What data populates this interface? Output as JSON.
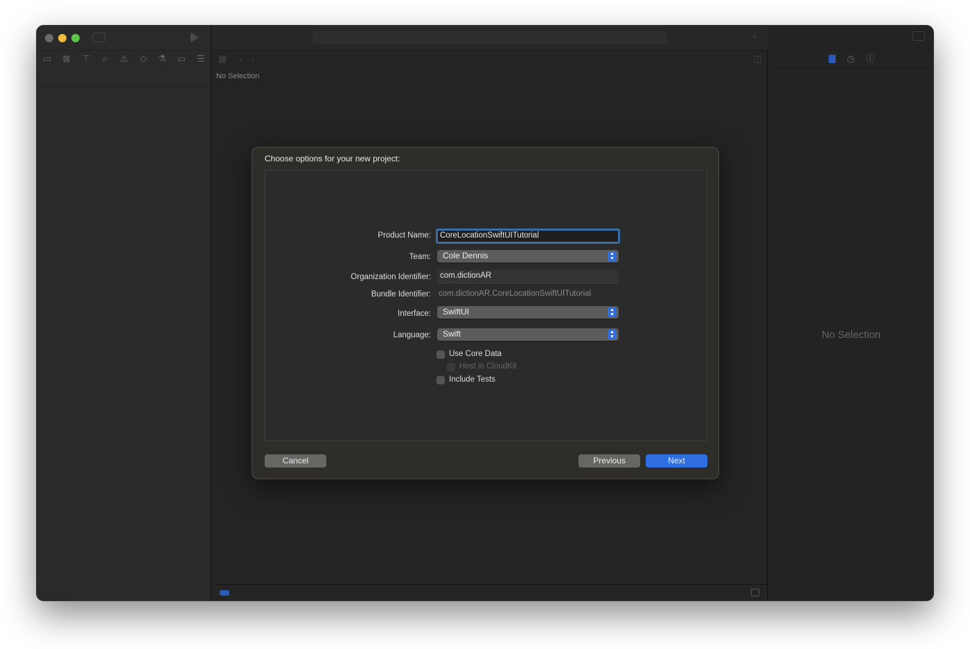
{
  "window": {
    "no_selection_editor": "No Selection",
    "no_selection_inspector": "No Selection"
  },
  "navigator_icons": [
    "folder-icon",
    "source-control-icon",
    "hierarchy-icon",
    "search-icon",
    "warning-icon",
    "test-icon",
    "debug-icon",
    "breakpoint-icon",
    "report-icon"
  ],
  "inspector_icons": [
    "file-icon",
    "history-icon",
    "help-icon"
  ],
  "colors": {
    "accent": "#2f6ee0",
    "inspector_active": "#2b5bb8"
  },
  "dialog": {
    "title": "Choose options for your new project:",
    "fields": {
      "product_name_label": "Product Name:",
      "product_name": "CoreLocationSwiftUITutorial",
      "team_label": "Team:",
      "team": "Cole Dennis",
      "org_label": "Organization Identifier:",
      "org": "com.dictionAR",
      "bundle_label": "Bundle Identifier:",
      "bundle": "com.dictionAR.CoreLocationSwiftUITutorial",
      "interface_label": "Interface:",
      "interface": "SwiftUI",
      "language_label": "Language:",
      "language": "Swift"
    },
    "checkboxes": {
      "core_data": "Use Core Data",
      "cloudkit": "Host in CloudKit",
      "tests": "Include Tests"
    },
    "buttons": {
      "cancel": "Cancel",
      "previous": "Previous",
      "next": "Next"
    }
  }
}
